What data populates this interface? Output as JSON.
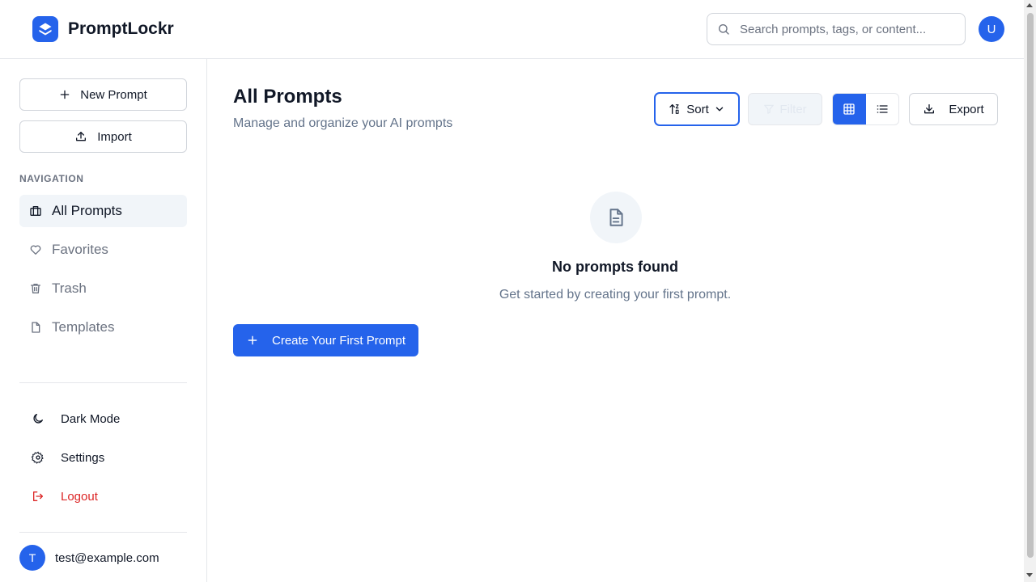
{
  "app": {
    "name": "PromptLockr",
    "avatar_initial": "U",
    "accent_color": "#2563eb"
  },
  "search": {
    "placeholder": "Search prompts, tags, or content...",
    "value": ""
  },
  "sidebar": {
    "new_prompt_label": "New Prompt",
    "import_label": "Import",
    "nav_heading": "NAVIGATION",
    "nav_items": [
      {
        "label": "All Prompts",
        "icon": "folder-icon",
        "active": true
      },
      {
        "label": "Favorites",
        "icon": "heart-icon",
        "active": false
      },
      {
        "label": "Trash",
        "icon": "trash-icon",
        "active": false
      },
      {
        "label": "Templates",
        "icon": "file-icon",
        "active": false
      }
    ],
    "bottom_items": [
      {
        "label": "Dark Mode",
        "icon": "moon-icon"
      },
      {
        "label": "Settings",
        "icon": "gear-icon"
      },
      {
        "label": "Logout",
        "icon": "logout-icon",
        "color": "#dc2626"
      }
    ],
    "user": {
      "initial": "T",
      "email": "test@example.com"
    }
  },
  "main": {
    "title": "All Prompts",
    "subtitle": "Manage and organize your AI prompts",
    "toolbar": {
      "sort_label": "Sort",
      "filter_label": "Filter",
      "view_mode": "grid",
      "export_label": "Export"
    },
    "empty_state": {
      "title": "No prompts found",
      "description": "Get started by creating your first prompt.",
      "cta_label": "Create Your First Prompt"
    }
  }
}
